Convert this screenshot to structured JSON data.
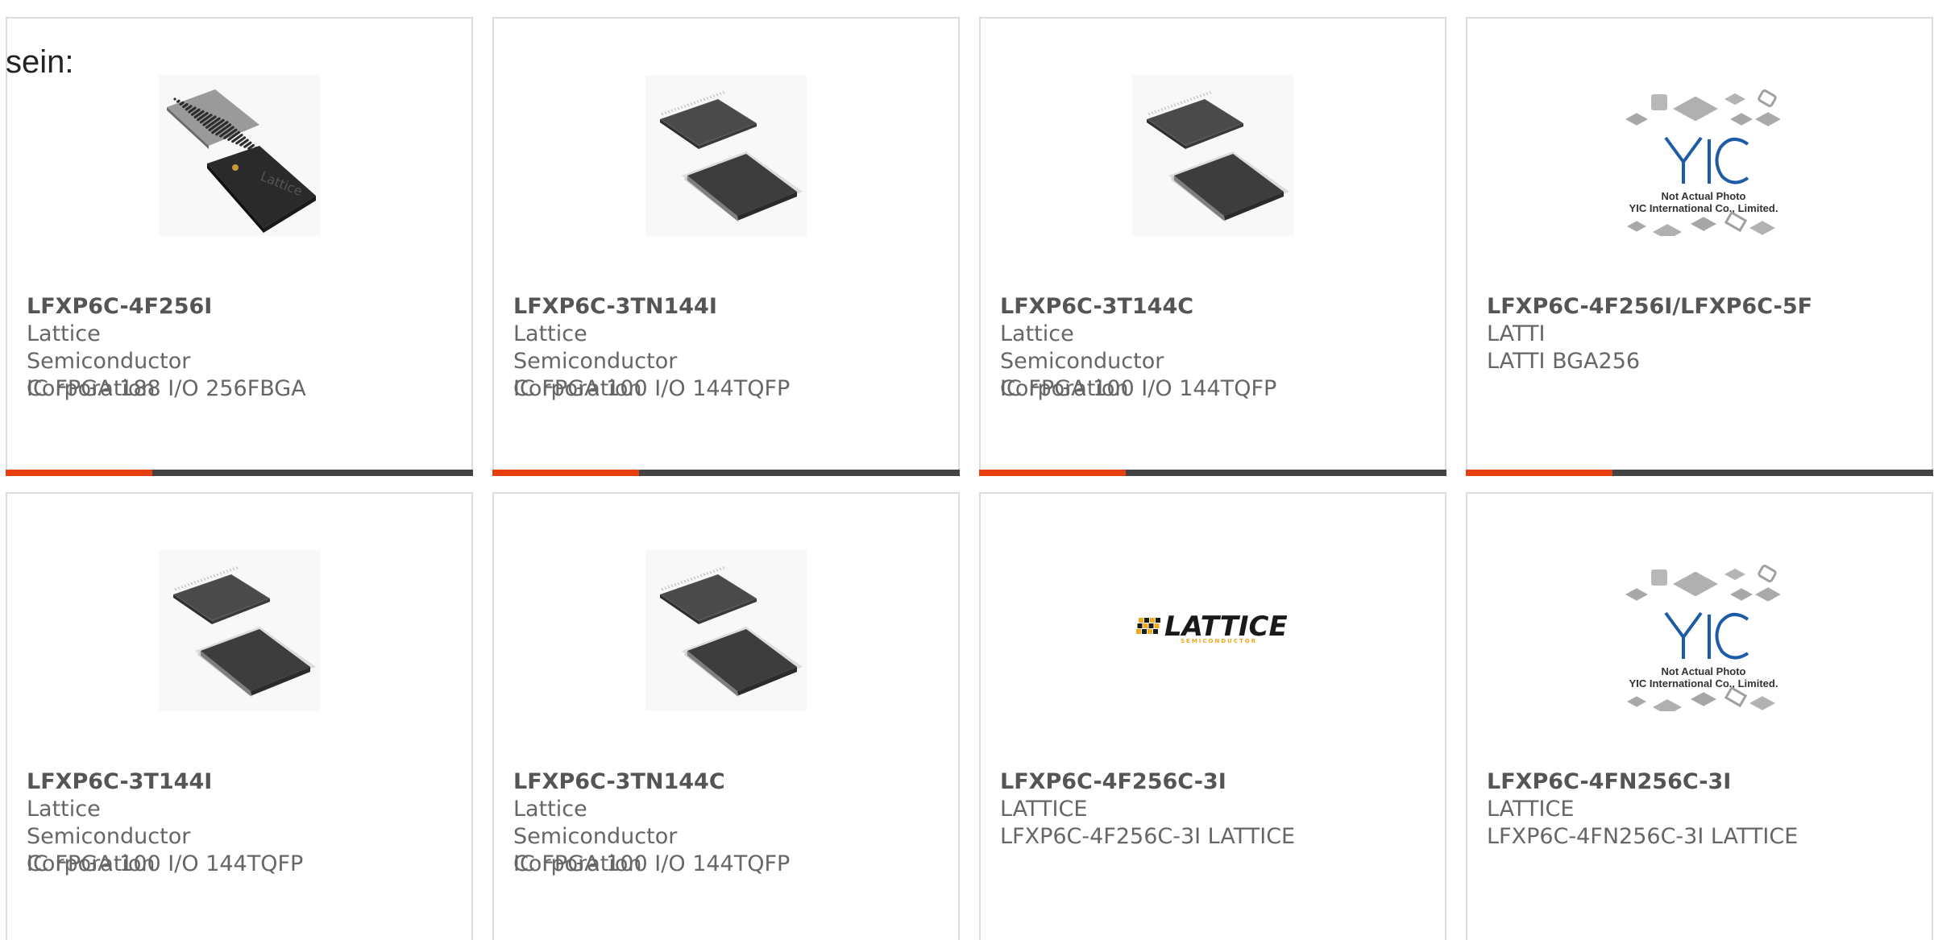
{
  "intro_text": "sein:",
  "colors": {
    "accent": "#e8400c",
    "bar": "#444444",
    "border": "#dddddd",
    "text": "#666666"
  },
  "products": [
    {
      "part_number": "LFXP6C-4F256I",
      "manufacturer": "Lattice Semiconductor Corporation",
      "description": "IC FPGA 188 I/O 256FBGA",
      "image": "bga-chip-icon"
    },
    {
      "part_number": "LFXP6C-3TN144I",
      "manufacturer": "Lattice Semiconductor Corporation",
      "description": "IC FPGA 100 I/O 144TQFP",
      "image": "tqfp-chip-icon"
    },
    {
      "part_number": "LFXP6C-3T144C",
      "manufacturer": "Lattice Semiconductor Corporation",
      "description": "IC FPGA 100 I/O 144TQFP",
      "image": "tqfp-chip-icon"
    },
    {
      "part_number": "LFXP6C-4F256I/LFXP6C-5F",
      "manufacturer": "LATTI",
      "description": "LATTI BGA256",
      "image": "yic-placeholder-icon",
      "image_caption_1": "Not Actual Photo",
      "image_caption_2": "YIC International Co., Limited.",
      "image_logo": "YIC"
    },
    {
      "part_number": "LFXP6C-3T144I",
      "manufacturer": "Lattice Semiconductor Corporation",
      "description": "IC FPGA 100 I/O 144TQFP",
      "image": "tqfp-chip-icon"
    },
    {
      "part_number": "LFXP6C-3TN144C",
      "manufacturer": "Lattice Semiconductor Corporation",
      "description": "IC FPGA 100 I/O 144TQFP",
      "image": "tqfp-chip-icon"
    },
    {
      "part_number": "LFXP6C-4F256C-3I",
      "manufacturer": "LATTICE",
      "description": "LFXP6C-4F256C-3I LATTICE",
      "image": "lattice-logo-icon",
      "image_logo": "LATTICE",
      "image_logo_sub": "SEMICONDUCTOR"
    },
    {
      "part_number": "LFXP6C-4FN256C-3I",
      "manufacturer": "LATTICE",
      "description": "LFXP6C-4FN256C-3I LATTICE",
      "image": "yic-placeholder-icon",
      "image_caption_1": "Not Actual Photo",
      "image_caption_2": "YIC International Co., Limited.",
      "image_logo": "YIC"
    }
  ]
}
